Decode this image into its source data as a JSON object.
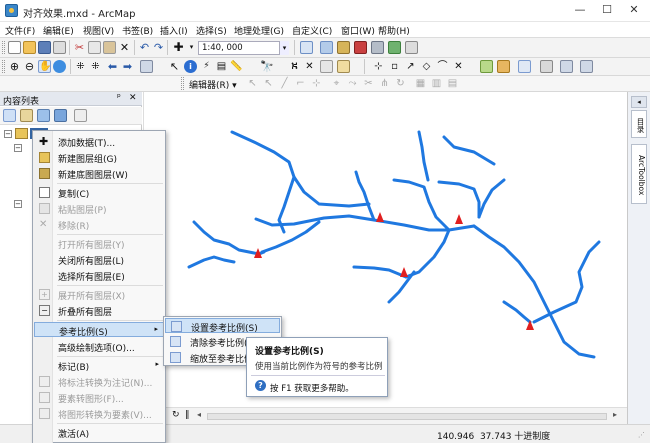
{
  "window": {
    "title": "对齐效果.mxd - ArcMap",
    "controls": {
      "minimize": "—",
      "maximize": "☐",
      "close": "✕"
    }
  },
  "menubar": [
    "文件(F)",
    "编辑(E)",
    "视图(V)",
    "书签(B)",
    "插入(I)",
    "选择(S)",
    "地理处理(G)",
    "自定义(C)",
    "窗口(W)",
    "帮助(H)"
  ],
  "toolbar": {
    "scale": "1:40, 000",
    "editor_label": "编辑器(R)",
    "editor_arrow": "▾"
  },
  "toc": {
    "title": "内容列表",
    "pin": "ᵖ",
    "close": "✕"
  },
  "context_menu": {
    "items": [
      {
        "label": "添加数据(T)...",
        "icon": "add-data-icon",
        "enabled": true
      },
      {
        "label": "新建图层组(G)",
        "icon": "new-group-layer-icon",
        "enabled": true
      },
      {
        "label": "新建底图图层(W)",
        "icon": "new-basemap-layer-icon",
        "enabled": true
      },
      {
        "label": "复制(C)",
        "icon": "copy-icon",
        "enabled": true
      },
      {
        "label": "粘贴图层(P)",
        "icon": "paste-icon",
        "enabled": false
      },
      {
        "label": "移除(R)",
        "icon": "remove-icon",
        "enabled": false
      },
      {
        "label": "打开所有图层(Y)",
        "icon": "",
        "enabled": false
      },
      {
        "label": "关闭所有图层(L)",
        "icon": "",
        "enabled": true
      },
      {
        "label": "选择所有图层(E)",
        "icon": "",
        "enabled": true
      },
      {
        "label": "展开所有图层(X)",
        "icon": "expand-icon",
        "enabled": false
      },
      {
        "label": "折叠所有图层",
        "icon": "collapse-icon",
        "enabled": true
      },
      {
        "label": "参考比例(S)",
        "icon": "",
        "enabled": true,
        "submenu": true
      },
      {
        "label": "高级绘制选项(O)...",
        "icon": "",
        "enabled": true
      },
      {
        "label": "标记(B)",
        "icon": "",
        "enabled": true,
        "submenu": true
      },
      {
        "label": "将标注转换为注记(N)...",
        "icon": "convert-labels-icon",
        "enabled": false
      },
      {
        "label": "要素转图形(F)...",
        "icon": "features-to-graphics-icon",
        "enabled": false
      },
      {
        "label": "将图形转换为要素(V)...",
        "icon": "graphics-to-features-icon",
        "enabled": false
      },
      {
        "label": "激活(A)",
        "icon": "",
        "enabled": true
      }
    ]
  },
  "submenu": {
    "items": [
      {
        "label": "设置参考比例(S)",
        "icon": "set-reference-scale-icon"
      },
      {
        "label": "清除参考比例(E)",
        "icon": "clear-reference-scale-icon"
      },
      {
        "label": "缩放至参考比例(Z)",
        "icon": "zoom-reference-scale-icon"
      }
    ]
  },
  "tooltip": {
    "title": "设置参考比例(S)",
    "description": "使用当前比例作为符号的参考比例",
    "help": "按 F1 获取更多帮助。",
    "help_icon": "?"
  },
  "right_dock": {
    "tabs": [
      "目录",
      "ArcToolbox"
    ]
  },
  "status": {
    "coords": "140.946  37.743 十进制度"
  },
  "map": {
    "river_color": "#1f78e0",
    "marker_color": "#e02020"
  }
}
